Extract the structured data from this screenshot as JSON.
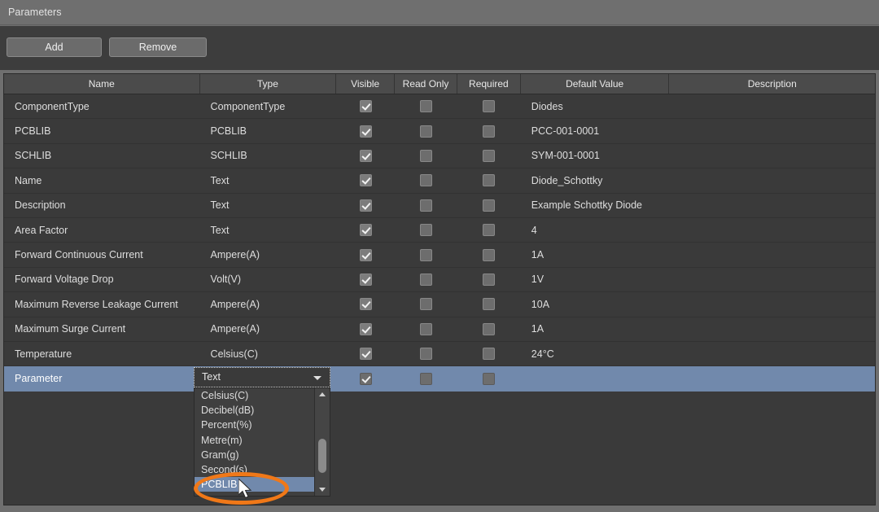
{
  "window": {
    "title": "Parameters"
  },
  "toolbar": {
    "add_label": "Add",
    "remove_label": "Remove"
  },
  "table": {
    "columns": [
      {
        "key": "name",
        "label": "Name"
      },
      {
        "key": "type",
        "label": "Type"
      },
      {
        "key": "visible",
        "label": "Visible"
      },
      {
        "key": "readonly",
        "label": "Read Only"
      },
      {
        "key": "required",
        "label": "Required"
      },
      {
        "key": "default",
        "label": "Default Value"
      },
      {
        "key": "desc",
        "label": "Description"
      }
    ],
    "rows": [
      {
        "name": "ComponentType",
        "type": "ComponentType",
        "visible": true,
        "readonly": false,
        "required": false,
        "default": "Diodes",
        "desc": ""
      },
      {
        "name": "PCBLIB",
        "type": "PCBLIB",
        "visible": true,
        "readonly": false,
        "required": false,
        "default": "PCC-001-0001",
        "desc": ""
      },
      {
        "name": "SCHLIB",
        "type": "SCHLIB",
        "visible": true,
        "readonly": false,
        "required": false,
        "default": "SYM-001-0001",
        "desc": ""
      },
      {
        "name": "Name",
        "type": "Text",
        "visible": true,
        "readonly": false,
        "required": false,
        "default": "Diode_Schottky",
        "desc": ""
      },
      {
        "name": "Description",
        "type": "Text",
        "visible": true,
        "readonly": false,
        "required": false,
        "default": "Example Schottky Diode",
        "desc": ""
      },
      {
        "name": "Area Factor",
        "type": "Text",
        "visible": true,
        "readonly": false,
        "required": false,
        "default": "4",
        "desc": ""
      },
      {
        "name": "Forward Continuous Current",
        "type": "Ampere(A)",
        "visible": true,
        "readonly": false,
        "required": false,
        "default": "1A",
        "desc": ""
      },
      {
        "name": "Forward Voltage Drop",
        "type": "Volt(V)",
        "visible": true,
        "readonly": false,
        "required": false,
        "default": "1V",
        "desc": ""
      },
      {
        "name": "Maximum Reverse Leakage Current",
        "type": "Ampere(A)",
        "visible": true,
        "readonly": false,
        "required": false,
        "default": "10A",
        "desc": ""
      },
      {
        "name": "Maximum Surge Current",
        "type": "Ampere(A)",
        "visible": true,
        "readonly": false,
        "required": false,
        "default": "1A",
        "desc": ""
      },
      {
        "name": "Temperature",
        "type": "Celsius(C)",
        "visible": true,
        "readonly": false,
        "required": false,
        "default": "24°C",
        "desc": ""
      },
      {
        "name": "Parameter",
        "type": "Text",
        "visible": true,
        "readonly": false,
        "required": false,
        "default": "",
        "desc": "",
        "selected": true,
        "editing": true
      }
    ]
  },
  "type_combo": {
    "value": "Text",
    "expanded": true,
    "options": [
      "Celsius(C)",
      "Decibel(dB)",
      "Percent(%)",
      "Metre(m)",
      "Gram(g)",
      "Second(s)",
      "PCBLIB"
    ],
    "highlighted": "PCBLIB"
  },
  "annotation": {
    "color": "#f07818",
    "shape": "ellipse",
    "target": "PCBLIB"
  },
  "colors": {
    "selection": "#7189ac",
    "panel": "#3a3a3a",
    "header": "#4b4b4b",
    "titlebar": "#6f6f6f",
    "accent": "#f07818"
  }
}
